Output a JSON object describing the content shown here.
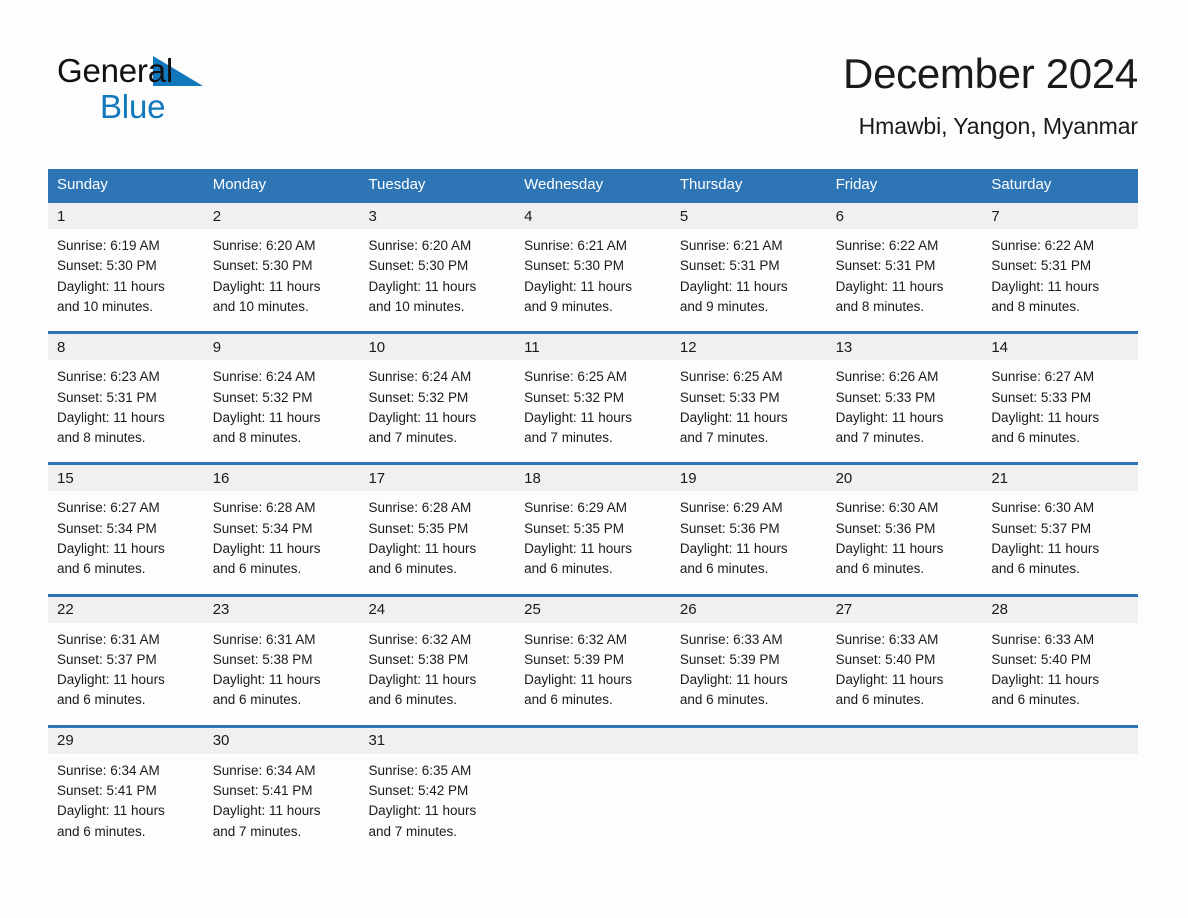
{
  "logo": {
    "line1": "General",
    "line2": "Blue",
    "triangle_icon": "blue-triangle",
    "line1_color": "#111111",
    "line2_color": "#1278be"
  },
  "header": {
    "month_title": "December 2024",
    "location": "Hmawbi, Yangon, Myanmar"
  },
  "colors": {
    "header_bar": "#2e75b6",
    "rule": "#2e75b6",
    "date_band": "#f0f0f0",
    "page_background": "#fdfdfd",
    "text": "#1a1a1a"
  },
  "calendar": {
    "day_headers": [
      "Sunday",
      "Monday",
      "Tuesday",
      "Wednesday",
      "Thursday",
      "Friday",
      "Saturday"
    ],
    "weeks": [
      {
        "days": [
          {
            "date": "1",
            "sunrise": "Sunrise: 6:19 AM",
            "sunset": "Sunset: 5:30 PM",
            "daylight_line1": "Daylight: 11 hours",
            "daylight_line2": "and 10 minutes."
          },
          {
            "date": "2",
            "sunrise": "Sunrise: 6:20 AM",
            "sunset": "Sunset: 5:30 PM",
            "daylight_line1": "Daylight: 11 hours",
            "daylight_line2": "and 10 minutes."
          },
          {
            "date": "3",
            "sunrise": "Sunrise: 6:20 AM",
            "sunset": "Sunset: 5:30 PM",
            "daylight_line1": "Daylight: 11 hours",
            "daylight_line2": "and 10 minutes."
          },
          {
            "date": "4",
            "sunrise": "Sunrise: 6:21 AM",
            "sunset": "Sunset: 5:30 PM",
            "daylight_line1": "Daylight: 11 hours",
            "daylight_line2": "and 9 minutes."
          },
          {
            "date": "5",
            "sunrise": "Sunrise: 6:21 AM",
            "sunset": "Sunset: 5:31 PM",
            "daylight_line1": "Daylight: 11 hours",
            "daylight_line2": "and 9 minutes."
          },
          {
            "date": "6",
            "sunrise": "Sunrise: 6:22 AM",
            "sunset": "Sunset: 5:31 PM",
            "daylight_line1": "Daylight: 11 hours",
            "daylight_line2": "and 8 minutes."
          },
          {
            "date": "7",
            "sunrise": "Sunrise: 6:22 AM",
            "sunset": "Sunset: 5:31 PM",
            "daylight_line1": "Daylight: 11 hours",
            "daylight_line2": "and 8 minutes."
          }
        ]
      },
      {
        "days": [
          {
            "date": "8",
            "sunrise": "Sunrise: 6:23 AM",
            "sunset": "Sunset: 5:31 PM",
            "daylight_line1": "Daylight: 11 hours",
            "daylight_line2": "and 8 minutes."
          },
          {
            "date": "9",
            "sunrise": "Sunrise: 6:24 AM",
            "sunset": "Sunset: 5:32 PM",
            "daylight_line1": "Daylight: 11 hours",
            "daylight_line2": "and 8 minutes."
          },
          {
            "date": "10",
            "sunrise": "Sunrise: 6:24 AM",
            "sunset": "Sunset: 5:32 PM",
            "daylight_line1": "Daylight: 11 hours",
            "daylight_line2": "and 7 minutes."
          },
          {
            "date": "11",
            "sunrise": "Sunrise: 6:25 AM",
            "sunset": "Sunset: 5:32 PM",
            "daylight_line1": "Daylight: 11 hours",
            "daylight_line2": "and 7 minutes."
          },
          {
            "date": "12",
            "sunrise": "Sunrise: 6:25 AM",
            "sunset": "Sunset: 5:33 PM",
            "daylight_line1": "Daylight: 11 hours",
            "daylight_line2": "and 7 minutes."
          },
          {
            "date": "13",
            "sunrise": "Sunrise: 6:26 AM",
            "sunset": "Sunset: 5:33 PM",
            "daylight_line1": "Daylight: 11 hours",
            "daylight_line2": "and 7 minutes."
          },
          {
            "date": "14",
            "sunrise": "Sunrise: 6:27 AM",
            "sunset": "Sunset: 5:33 PM",
            "daylight_line1": "Daylight: 11 hours",
            "daylight_line2": "and 6 minutes."
          }
        ]
      },
      {
        "days": [
          {
            "date": "15",
            "sunrise": "Sunrise: 6:27 AM",
            "sunset": "Sunset: 5:34 PM",
            "daylight_line1": "Daylight: 11 hours",
            "daylight_line2": "and 6 minutes."
          },
          {
            "date": "16",
            "sunrise": "Sunrise: 6:28 AM",
            "sunset": "Sunset: 5:34 PM",
            "daylight_line1": "Daylight: 11 hours",
            "daylight_line2": "and 6 minutes."
          },
          {
            "date": "17",
            "sunrise": "Sunrise: 6:28 AM",
            "sunset": "Sunset: 5:35 PM",
            "daylight_line1": "Daylight: 11 hours",
            "daylight_line2": "and 6 minutes."
          },
          {
            "date": "18",
            "sunrise": "Sunrise: 6:29 AM",
            "sunset": "Sunset: 5:35 PM",
            "daylight_line1": "Daylight: 11 hours",
            "daylight_line2": "and 6 minutes."
          },
          {
            "date": "19",
            "sunrise": "Sunrise: 6:29 AM",
            "sunset": "Sunset: 5:36 PM",
            "daylight_line1": "Daylight: 11 hours",
            "daylight_line2": "and 6 minutes."
          },
          {
            "date": "20",
            "sunrise": "Sunrise: 6:30 AM",
            "sunset": "Sunset: 5:36 PM",
            "daylight_line1": "Daylight: 11 hours",
            "daylight_line2": "and 6 minutes."
          },
          {
            "date": "21",
            "sunrise": "Sunrise: 6:30 AM",
            "sunset": "Sunset: 5:37 PM",
            "daylight_line1": "Daylight: 11 hours",
            "daylight_line2": "and 6 minutes."
          }
        ]
      },
      {
        "days": [
          {
            "date": "22",
            "sunrise": "Sunrise: 6:31 AM",
            "sunset": "Sunset: 5:37 PM",
            "daylight_line1": "Daylight: 11 hours",
            "daylight_line2": "and 6 minutes."
          },
          {
            "date": "23",
            "sunrise": "Sunrise: 6:31 AM",
            "sunset": "Sunset: 5:38 PM",
            "daylight_line1": "Daylight: 11 hours",
            "daylight_line2": "and 6 minutes."
          },
          {
            "date": "24",
            "sunrise": "Sunrise: 6:32 AM",
            "sunset": "Sunset: 5:38 PM",
            "daylight_line1": "Daylight: 11 hours",
            "daylight_line2": "and 6 minutes."
          },
          {
            "date": "25",
            "sunrise": "Sunrise: 6:32 AM",
            "sunset": "Sunset: 5:39 PM",
            "daylight_line1": "Daylight: 11 hours",
            "daylight_line2": "and 6 minutes."
          },
          {
            "date": "26",
            "sunrise": "Sunrise: 6:33 AM",
            "sunset": "Sunset: 5:39 PM",
            "daylight_line1": "Daylight: 11 hours",
            "daylight_line2": "and 6 minutes."
          },
          {
            "date": "27",
            "sunrise": "Sunrise: 6:33 AM",
            "sunset": "Sunset: 5:40 PM",
            "daylight_line1": "Daylight: 11 hours",
            "daylight_line2": "and 6 minutes."
          },
          {
            "date": "28",
            "sunrise": "Sunrise: 6:33 AM",
            "sunset": "Sunset: 5:40 PM",
            "daylight_line1": "Daylight: 11 hours",
            "daylight_line2": "and 6 minutes."
          }
        ]
      },
      {
        "days": [
          {
            "date": "29",
            "sunrise": "Sunrise: 6:34 AM",
            "sunset": "Sunset: 5:41 PM",
            "daylight_line1": "Daylight: 11 hours",
            "daylight_line2": "and 6 minutes."
          },
          {
            "date": "30",
            "sunrise": "Sunrise: 6:34 AM",
            "sunset": "Sunset: 5:41 PM",
            "daylight_line1": "Daylight: 11 hours",
            "daylight_line2": "and 7 minutes."
          },
          {
            "date": "31",
            "sunrise": "Sunrise: 6:35 AM",
            "sunset": "Sunset: 5:42 PM",
            "daylight_line1": "Daylight: 11 hours",
            "daylight_line2": "and 7 minutes."
          },
          {
            "date": "",
            "sunrise": "",
            "sunset": "",
            "daylight_line1": "",
            "daylight_line2": ""
          },
          {
            "date": "",
            "sunrise": "",
            "sunset": "",
            "daylight_line1": "",
            "daylight_line2": ""
          },
          {
            "date": "",
            "sunrise": "",
            "sunset": "",
            "daylight_line1": "",
            "daylight_line2": ""
          },
          {
            "date": "",
            "sunrise": "",
            "sunset": "",
            "daylight_line1": "",
            "daylight_line2": ""
          }
        ]
      }
    ]
  }
}
